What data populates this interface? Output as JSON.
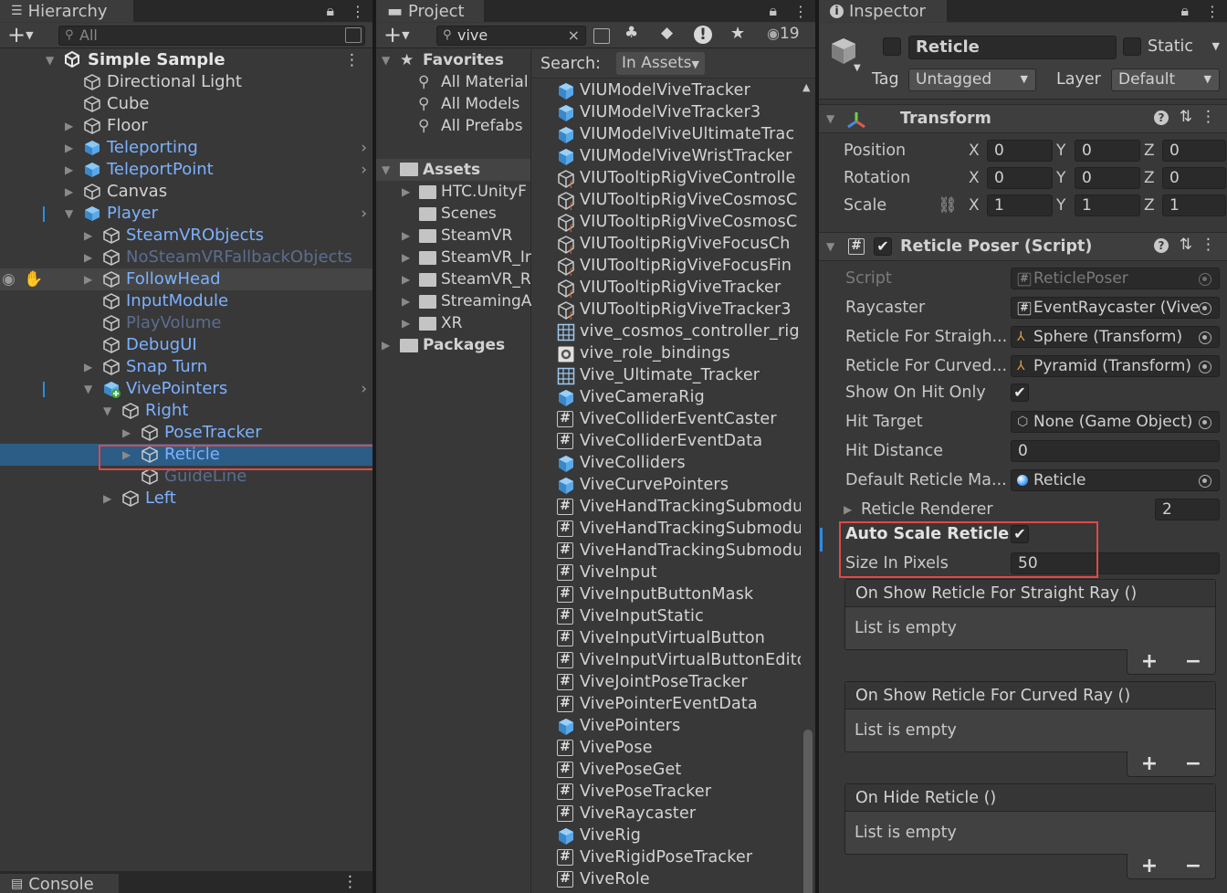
{
  "hierarchy": {
    "tab": "Hierarchy",
    "search_placeholder": "All",
    "items": [
      {
        "label": "Simple Sample",
        "depth": 0,
        "arrow": "down",
        "icon": "unity",
        "bold": true,
        "color": "normal"
      },
      {
        "label": "Directional Light",
        "depth": 1,
        "arrow": "",
        "icon": "cube",
        "color": "normal"
      },
      {
        "label": "Cube",
        "depth": 1,
        "arrow": "",
        "icon": "cube",
        "color": "normal"
      },
      {
        "label": "Floor",
        "depth": 1,
        "arrow": "right",
        "icon": "cube",
        "color": "normal"
      },
      {
        "label": "Teleporting",
        "depth": 1,
        "arrow": "right",
        "icon": "prefab",
        "color": "blue",
        "chevron": true
      },
      {
        "label": "TeleportPoint",
        "depth": 1,
        "arrow": "right",
        "icon": "prefab",
        "color": "blue",
        "chevron": true
      },
      {
        "label": "Canvas",
        "depth": 1,
        "arrow": "right",
        "icon": "cube",
        "color": "normal"
      },
      {
        "label": "Player",
        "depth": 1,
        "arrow": "down",
        "icon": "prefab",
        "color": "blue",
        "chevron": true,
        "mark": true
      },
      {
        "label": "SteamVRObjects",
        "depth": 2,
        "arrow": "right",
        "icon": "cube",
        "color": "blue"
      },
      {
        "label": "NoSteamVRFallbackObjects",
        "depth": 2,
        "arrow": "right",
        "icon": "cube",
        "color": "dim"
      },
      {
        "label": "FollowHead",
        "depth": 2,
        "arrow": "right",
        "icon": "cube",
        "color": "blue",
        "rowbg": true
      },
      {
        "label": "InputModule",
        "depth": 2,
        "arrow": "",
        "icon": "cube",
        "color": "blue"
      },
      {
        "label": "PlayVolume",
        "depth": 2,
        "arrow": "",
        "icon": "cube",
        "color": "dim"
      },
      {
        "label": "DebugUI",
        "depth": 2,
        "arrow": "",
        "icon": "cube",
        "color": "blue"
      },
      {
        "label": "Snap Turn",
        "depth": 2,
        "arrow": "right",
        "icon": "cube",
        "color": "blue"
      },
      {
        "label": "VivePointers",
        "depth": 2,
        "arrow": "down",
        "icon": "prefab-add",
        "color": "blue",
        "chevron": true,
        "mark": true
      },
      {
        "label": "Right",
        "depth": 3,
        "arrow": "down",
        "icon": "cube",
        "color": "blue"
      },
      {
        "label": "PoseTracker",
        "depth": 4,
        "arrow": "right",
        "icon": "cube",
        "color": "blue"
      },
      {
        "label": "Reticle",
        "depth": 4,
        "arrow": "right",
        "icon": "cube",
        "color": "blue",
        "selected": true
      },
      {
        "label": "GuideLine",
        "depth": 4,
        "arrow": "",
        "icon": "cube",
        "color": "dim"
      },
      {
        "label": "Left",
        "depth": 3,
        "arrow": "right",
        "icon": "cube",
        "color": "blue"
      }
    ],
    "console_tab": "Console"
  },
  "project": {
    "tab": "Project",
    "search_value": "vive",
    "hidden_count": "19",
    "favorites": {
      "label": "Favorites",
      "items": [
        "All Material",
        "All Models",
        "All Prefabs"
      ]
    },
    "assets": {
      "label": "Assets",
      "folders": [
        {
          "label": "HTC.UnityF",
          "arrow": true
        },
        {
          "label": "Scenes",
          "arrow": false
        },
        {
          "label": "SteamVR",
          "arrow": true
        },
        {
          "label": "SteamVR_Ir",
          "arrow": true
        },
        {
          "label": "SteamVR_R",
          "arrow": true
        },
        {
          "label": "StreamingA",
          "arrow": true
        },
        {
          "label": "XR",
          "arrow": true
        }
      ]
    },
    "packages": "Packages",
    "search_label": "Search:",
    "search_scope": "In Assets",
    "results": [
      {
        "name": "VIUModelViveTracker",
        "icon": "prefab"
      },
      {
        "name": "VIUModelViveTracker3",
        "icon": "prefab"
      },
      {
        "name": "VIUModelViveUltimateTrac",
        "icon": "prefab"
      },
      {
        "name": "VIUModelViveWristTracker",
        "icon": "prefab"
      },
      {
        "name": "VIUTooltipRigViveControlle",
        "icon": "variant"
      },
      {
        "name": "VIUTooltipRigViveCosmosC",
        "icon": "variant"
      },
      {
        "name": "VIUTooltipRigViveCosmosC",
        "icon": "variant"
      },
      {
        "name": "VIUTooltipRigViveFocusCh",
        "icon": "variant"
      },
      {
        "name": "VIUTooltipRigViveFocusFin",
        "icon": "variant"
      },
      {
        "name": "VIUTooltipRigViveTracker",
        "icon": "variant"
      },
      {
        "name": "VIUTooltipRigViveTracker3",
        "icon": "variant"
      },
      {
        "name": "vive_cosmos_controller_rigl",
        "icon": "grid"
      },
      {
        "name": "vive_role_bindings",
        "icon": "gear"
      },
      {
        "name": "Vive_Ultimate_Tracker",
        "icon": "grid"
      },
      {
        "name": "ViveCameraRig",
        "icon": "prefab"
      },
      {
        "name": "ViveColliderEventCaster",
        "icon": "script"
      },
      {
        "name": "ViveColliderEventData",
        "icon": "script"
      },
      {
        "name": "ViveColliders",
        "icon": "prefab"
      },
      {
        "name": "ViveCurvePointers",
        "icon": "prefab"
      },
      {
        "name": "ViveHandTrackingSubmodu",
        "icon": "script"
      },
      {
        "name": "ViveHandTrackingSubmodu",
        "icon": "script"
      },
      {
        "name": "ViveHandTrackingSubmodu",
        "icon": "script"
      },
      {
        "name": "ViveInput",
        "icon": "script"
      },
      {
        "name": "ViveInputButtonMask",
        "icon": "script"
      },
      {
        "name": "ViveInputStatic",
        "icon": "script"
      },
      {
        "name": "ViveInputVirtualButton",
        "icon": "script"
      },
      {
        "name": "ViveInputVirtualButtonEditc",
        "icon": "script"
      },
      {
        "name": "ViveJointPoseTracker",
        "icon": "script"
      },
      {
        "name": "VivePointerEventData",
        "icon": "script"
      },
      {
        "name": "VivePointers",
        "icon": "prefab"
      },
      {
        "name": "VivePose",
        "icon": "script"
      },
      {
        "name": "VivePoseGet",
        "icon": "script"
      },
      {
        "name": "VivePoseTracker",
        "icon": "script"
      },
      {
        "name": "ViveRaycaster",
        "icon": "script"
      },
      {
        "name": "ViveRig",
        "icon": "prefab"
      },
      {
        "name": "ViveRigidPoseTracker",
        "icon": "script"
      },
      {
        "name": "ViveRole",
        "icon": "script"
      }
    ]
  },
  "inspector": {
    "tab": "Inspector",
    "object_name": "Reticle",
    "static_label": "Static",
    "tag_label": "Tag",
    "tag_value": "Untagged",
    "layer_label": "Layer",
    "layer_value": "Default",
    "transform": {
      "title": "Transform",
      "rows": [
        {
          "label": "Position",
          "x": "0",
          "y": "0",
          "z": "0"
        },
        {
          "label": "Rotation",
          "x": "0",
          "y": "0",
          "z": "0"
        },
        {
          "label": "Scale",
          "x": "1",
          "y": "1",
          "z": "1"
        }
      ]
    },
    "poser": {
      "title": "Reticle Poser (Script)",
      "script_label": "Script",
      "script_value": "ReticlePoser",
      "raycaster_label": "Raycaster",
      "raycaster_value": "EventRaycaster (Vive",
      "straight_label": "Reticle For Straigh...",
      "straight_value": "Sphere (Transform)",
      "curved_label": "Reticle For Curved...",
      "curved_value": "Pyramid (Transform)",
      "showhit_label": "Show On Hit Only",
      "hittarget_label": "Hit Target",
      "hittarget_value": "None (Game Object)",
      "hitdist_label": "Hit Distance",
      "hitdist_value": "0",
      "defmat_label": "Default Reticle Ma...",
      "defmat_value": "Reticle",
      "renderer_label": "Reticle Renderer",
      "renderer_value": "2",
      "autoscale_label": "Auto Scale Reticle",
      "size_label": "Size In Pixels",
      "size_value": "50",
      "events": [
        {
          "title": "On Show Reticle For Straight Ray ()",
          "body": "List is empty"
        },
        {
          "title": "On Show Reticle For Curved Ray ()",
          "body": "List is empty"
        },
        {
          "title": "On Hide Reticle ()",
          "body": "List is empty"
        }
      ]
    }
  },
  "colors": {
    "panel": "#383838",
    "selection": "#2c5d87",
    "highlight": "#e04848",
    "link": "#7cb1ff"
  }
}
